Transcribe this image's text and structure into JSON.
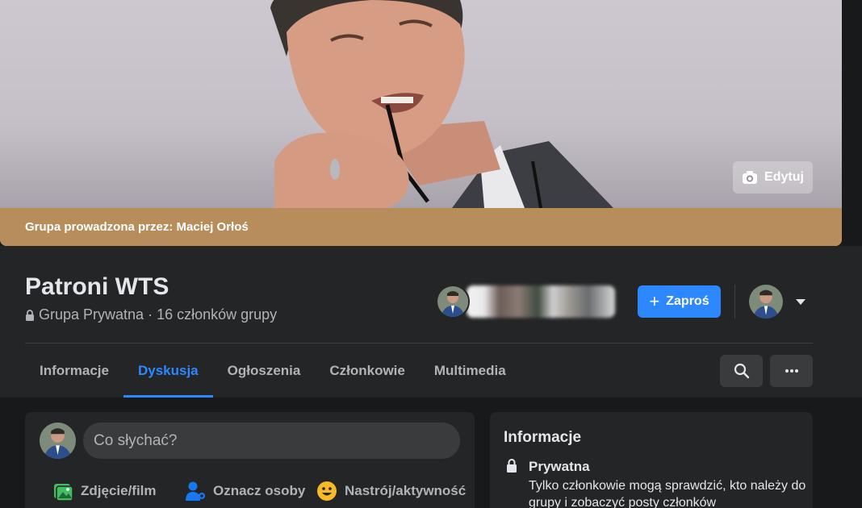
{
  "cover": {
    "edit_label": "Edytuj",
    "banner_text": "Grupa prowadzona przez: Maciej Orłoś",
    "banner_color": "#b78d5c"
  },
  "group": {
    "name": "Patroni WTS",
    "privacy": "Grupa Prywatna",
    "separator": "·",
    "members": "16 członków grupy"
  },
  "actions": {
    "invite_label": "Zaproś",
    "accent_color": "#2d88ff"
  },
  "tabs": [
    {
      "label": "Informacje",
      "active": false
    },
    {
      "label": "Dyskusja",
      "active": true
    },
    {
      "label": "Ogłoszenia",
      "active": false
    },
    {
      "label": "Członkowie",
      "active": false
    },
    {
      "label": "Multimedia",
      "active": false
    }
  ],
  "composer": {
    "placeholder": "Co słychać?",
    "photo_label": "Zdjęcie/film",
    "tag_label": "Oznacz osoby",
    "mood_label": "Nastrój/aktywność"
  },
  "info": {
    "title": "Informacje",
    "privacy_title": "Prywatna",
    "privacy_desc": "Tylko członkowie mogą sprawdzić, kto należy do grupy i zobaczyć posty członków"
  },
  "icons": {
    "camera": "camera-icon",
    "lock": "lock-icon",
    "search": "search-icon",
    "more": "more-icon",
    "photo": "photo-icon",
    "tag": "tag-people-icon",
    "mood": "mood-icon",
    "caret": "caret-down-icon"
  }
}
